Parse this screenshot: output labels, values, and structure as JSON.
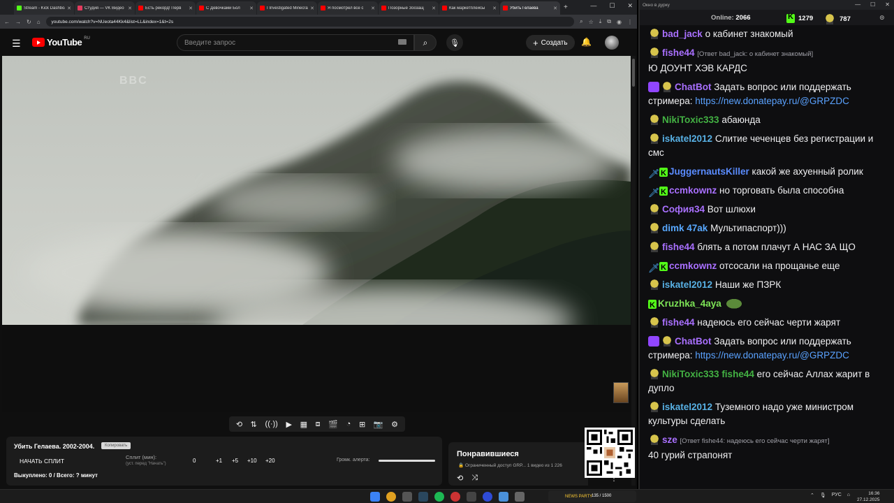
{
  "browser": {
    "tabs": [
      {
        "title": "Stream - Kick Dashboard",
        "color": "#53fc18"
      },
      {
        "title": "Студия — VK Видео",
        "color": "#e33b5e"
      },
      {
        "title": "Есть рекорд! Перв",
        "color": "#ff0000"
      },
      {
        "title": "С Девочками Бол",
        "color": "#ff0000"
      },
      {
        "title": "I Investigated Minecraft",
        "color": "#ff0000"
      },
      {
        "title": "Я посмотрел все с",
        "color": "#ff0000"
      },
      {
        "title": "Позорные Зоозащ",
        "color": "#ff0000"
      },
      {
        "title": "Как маркетплейсы",
        "color": "#ff0000"
      },
      {
        "title": "Убить Гелаева",
        "color": "#ff0000",
        "active": true
      }
    ],
    "url": "youtube.com/watch?v=NUeota44Kk4&list=LL&index=1&t=2s"
  },
  "youtube": {
    "logo": "YouTube",
    "region": "RU",
    "search_placeholder": "Введите запрос",
    "create_label": "Создать",
    "video_overlay": "BBC",
    "info": {
      "title": "Убить Гелаева. 2002-2004.",
      "copy_label": "Копировать",
      "split_button": "НАЧАТЬ СПЛИТ",
      "split_label": "Сплит (мин):",
      "split_hint": "(уст. перед \"Начать\")",
      "split_values": [
        "0",
        "+1",
        "+5",
        "+10",
        "+20"
      ],
      "alert_label": "Громк. алерта:",
      "alert_volume": 1.0,
      "bought": "Выкуплено: 0 / Всего: ? минут"
    },
    "liked": {
      "title": "Понравившиеся",
      "meta": "🔒 Ограниченный доступ  GRP...  1 видео из 1 226"
    }
  },
  "chat": {
    "window_title": "Окно в дурку",
    "online_label": "Online:",
    "online_count": "2066",
    "kick_count": "1279",
    "pepe_count": "787",
    "messages": [
      {
        "badges": [
          "pepe"
        ],
        "user": "bad_jack",
        "color": "#a970ff",
        "reply": "",
        "text": "о кабинет знакомый"
      },
      {
        "badges": [
          "pepe"
        ],
        "user": "fishe44",
        "color": "#a970ff",
        "reply": "[Ответ bad_jack: о кабинет знакомый]",
        "text": "Ю ДОУНТ ХЭВ КАРДС"
      },
      {
        "badges": [
          "bot",
          "pepe"
        ],
        "user": "ChatBot",
        "color": "#a970ff",
        "reply": "",
        "text": "Задать вопрос или поддержать стримера: ",
        "link": "https://new.donatepay.ru/@GRPZDC"
      },
      {
        "badges": [
          "pepe"
        ],
        "user": "NikiToxic333",
        "color": "#43b243",
        "reply": "",
        "text": "абаюнда"
      },
      {
        "badges": [
          "pepe"
        ],
        "user": "iskatel2012",
        "color": "#58b1e5",
        "reply": "",
        "text": "Слитие чеченцев без регистрации и смс"
      },
      {
        "badges": [
          "sword",
          "kick"
        ],
        "user": "JuggernautsKiller",
        "color": "#5a8cff",
        "reply": "",
        "text": "какой же ахуенный ролик"
      },
      {
        "badges": [
          "sword",
          "kick"
        ],
        "user": "ccmkownz",
        "color": "#a970ff",
        "reply": "",
        "text": "но торговать была способна"
      },
      {
        "badges": [
          "pepe"
        ],
        "user": "София34",
        "color": "#a970ff",
        "reply": "",
        "text": "Вот шлюхи"
      },
      {
        "badges": [
          "pepe"
        ],
        "user": "dimk 47ak",
        "color": "#58a8ff",
        "reply": "",
        "text": "Мультипаспорт)))"
      },
      {
        "badges": [
          "pepe"
        ],
        "user": "fishe44",
        "color": "#a970ff",
        "reply": "",
        "text": "блять а потом плачут А НАС ЗА ЩО"
      },
      {
        "badges": [
          "sword",
          "kick"
        ],
        "user": "ccmkownz",
        "color": "#a970ff",
        "reply": "",
        "text": "отсосали на прощанье еще"
      },
      {
        "badges": [
          "pepe"
        ],
        "user": "iskatel2012",
        "color": "#58b1e5",
        "reply": "",
        "text": "Наши же ПЗРК"
      },
      {
        "badges": [
          "kick"
        ],
        "user": "Kruzhka_4aya",
        "color": "#7de356",
        "reply": "",
        "text": "",
        "emote": "pepe"
      },
      {
        "badges": [
          "pepe"
        ],
        "user": "fishe44",
        "color": "#a970ff",
        "reply": "",
        "text": "надеюсь его сейчас черти жарят"
      },
      {
        "badges": [
          "bot",
          "pepe"
        ],
        "user": "ChatBot",
        "color": "#a970ff",
        "reply": "",
        "text": "Задать вопрос или поддержать стримера: ",
        "link": "https://new.donatepay.ru/@GRPZDC"
      },
      {
        "badges": [
          "pepe"
        ],
        "user": "NikiToxic333",
        "color": "#43b243",
        "reply": "",
        "mention": "fishe44",
        "text": "его сейчас Аллах жарит в дупло"
      },
      {
        "badges": [
          "pepe"
        ],
        "user": "iskatel2012",
        "color": "#58b1e5",
        "reply": "",
        "text": "Туземного надо уже министром культуры сделать"
      },
      {
        "badges": [
          "pepe"
        ],
        "user": "sze",
        "color": "#a970ff",
        "reply": "[Ответ fishe44: надеюсь его сейчас черти жарят]",
        "text": "40 гурий страпонят"
      }
    ]
  },
  "taskbar": {
    "news_label": "NEWS PARTY",
    "news_count": "135 / 1500",
    "lang": "РУС",
    "time": "16:36",
    "date": "27.12.2025"
  }
}
